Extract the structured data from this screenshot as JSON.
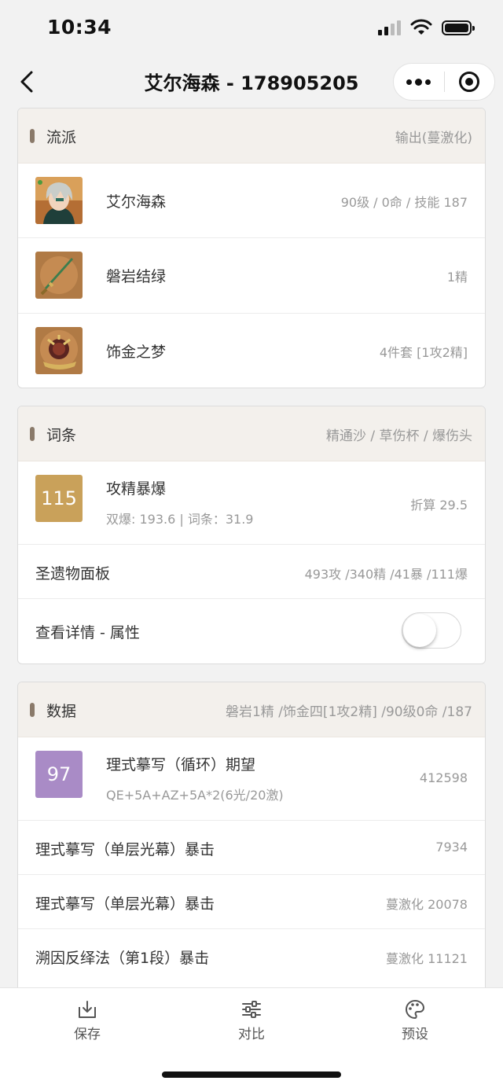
{
  "status_bar": {
    "time": "10:34"
  },
  "nav": {
    "title": "艾尔海森 - 178905205"
  },
  "build": {
    "header_title": "流派",
    "header_value": "输出(蔓激化)",
    "rows": [
      {
        "name": "艾尔海森",
        "detail": "90级 / 0命 / 技能 187",
        "icon": "character-portrait"
      },
      {
        "name": "磐岩结绿",
        "detail": "1精",
        "icon": "sword-weapon"
      },
      {
        "name": "饰金之梦",
        "detail": "4件套 [1攻2精]",
        "icon": "artifact-flower"
      }
    ]
  },
  "stats": {
    "header_title": "词条",
    "header_value": "精通沙 / 草伤杯 / 爆伤头",
    "score": "115",
    "score_color": "#c9a15a",
    "score_title": "攻精暴爆",
    "score_sub": "双爆: 193.6 | 词条：31.9",
    "score_right": "折算 29.5",
    "panel_label": "圣遗物面板",
    "panel_value": "493攻 /340精 /41暴 /111爆",
    "detail_label": "查看详情 - 属性",
    "detail_toggle_on": false
  },
  "data": {
    "header_title": "数据",
    "header_value": "磐岩1精 /饰金四[1攻2精] /90级0命 /187",
    "score": "97",
    "score_color": "#a98bc6",
    "score_title": "理式摹写（循环）期望",
    "score_sub": "QE+5A+AZ+5A*2(6光/20激)",
    "score_right": "412598",
    "rows": [
      {
        "label": "理式摹写（单层光幕）暴击",
        "value": "7934"
      },
      {
        "label": "理式摹写（单层光幕）暴击",
        "value": "蔓激化 20078"
      },
      {
        "label": "溯因反绎法（第1段）暴击",
        "value": "蔓激化 11121"
      }
    ]
  },
  "tabbar": {
    "save": "保存",
    "compare": "对比",
    "preset": "预设"
  }
}
